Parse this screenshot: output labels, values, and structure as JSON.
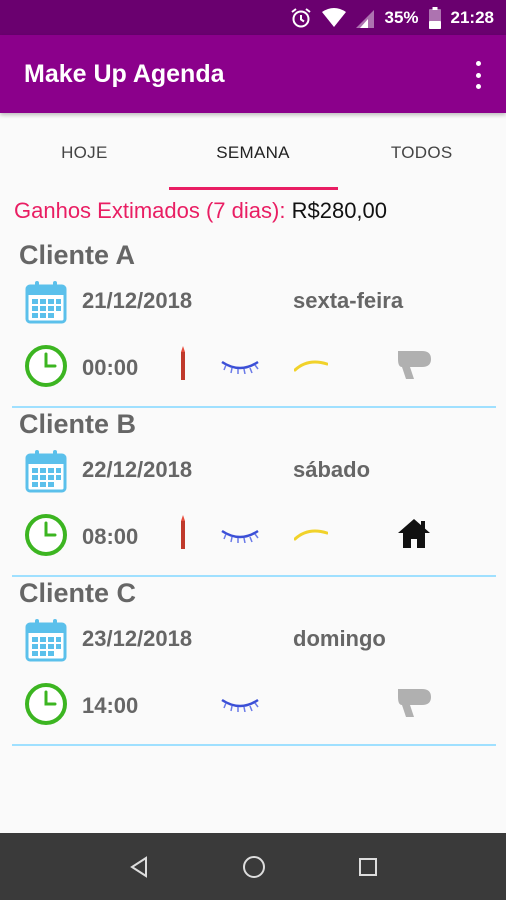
{
  "status_bar": {
    "battery": "35%",
    "time": "21:28"
  },
  "app_bar": {
    "title": "Make Up Agenda"
  },
  "tabs": [
    {
      "label": "HOJE",
      "active": false
    },
    {
      "label": "SEMANA",
      "active": true
    },
    {
      "label": "TODOS",
      "active": false
    }
  ],
  "earnings": {
    "label": "Ganhos Extimados (7 dias):",
    "value": "R$280,00"
  },
  "appointments": [
    {
      "client": "Cliente A",
      "date": "21/12/2018",
      "weekday": "sexta-feira",
      "time": "00:00",
      "services": [
        "lipstick-icon",
        "eyelash-icon",
        "eyebrow-icon",
        "hair-dryer-icon"
      ]
    },
    {
      "client": "Cliente B",
      "date": "22/12/2018",
      "weekday": "sábado",
      "time": "08:00",
      "services": [
        "lipstick-icon",
        "eyelash-icon",
        "eyebrow-icon",
        "home-icon"
      ]
    },
    {
      "client": "Cliente C",
      "date": "23/12/2018",
      "weekday": "domingo",
      "time": "14:00",
      "services": [
        "eyelash-icon",
        "hair-dryer-icon"
      ]
    }
  ],
  "colors": {
    "status_bar": "#6a006f",
    "app_bar": "#8b008b",
    "accent": "#e91e63",
    "divider": "#9fe0ff",
    "calendar": "#5bc0eb",
    "clock": "#3cb521"
  }
}
